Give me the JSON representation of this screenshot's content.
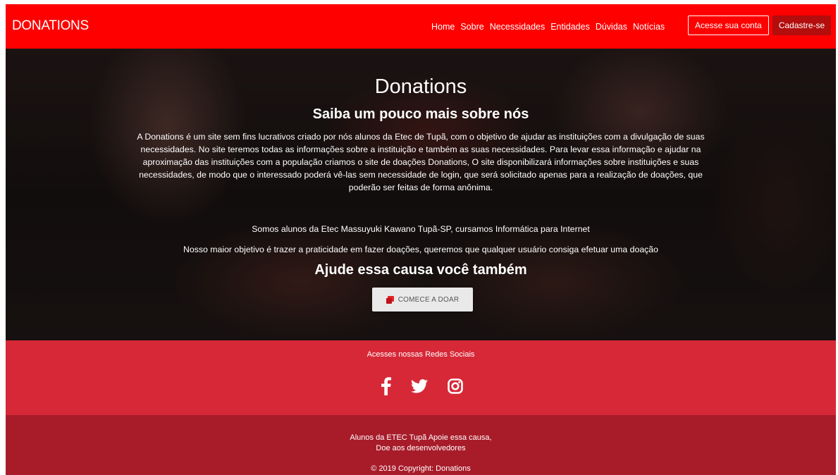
{
  "nav": {
    "brand": "DONATIONS",
    "links": [
      "Home",
      "Sobre",
      "Necessidades",
      "Entidades",
      "Dúvidas",
      "Notícias"
    ],
    "login_button": "Acesse sua conta",
    "signup_button": "Cadastre-se"
  },
  "hero": {
    "title": "Donations",
    "subtitle": "Saiba um pouco mais sobre nós",
    "paragraph": "A Donations é um site sem fins lucrativos criado por nós alunos da Etec de Tupã, com o objetivo de ajudar as instituições com a divulgação de suas necessidades. No site teremos todas as informações sobre a instituição e também as suas necessidades. Para levar essa informação e ajudar na aproximação das instituições com a população criamos o site de doações Donations, O site disponibilizará informações sobre instituições e suas necessidades, de modo que o interessado poderá vê-las sem necessidade de login, que será solicitado apenas para a realização de doações, que poderão ser feitas de forma anônima.",
    "line1": "Somos alunos da Etec Massuyuki Kawano Tupã-SP, cursamos Informática para Internet",
    "line2": "Nosso maior objetivo é trazer a praticidade em fazer doações, queremos que qualquer usuário consiga efetuar uma doação",
    "call_to_action": "Ajude essa causa você também",
    "donate_button": "COMECE A DOAR"
  },
  "social": {
    "title": "Acesses nossas Redes Sociais",
    "icons": [
      "facebook-icon",
      "twitter-icon",
      "instagram-icon"
    ]
  },
  "footer": {
    "line1": "Alunos da ETEC Tupã Apoie essa causa,",
    "line2": "Doe aos desenvolvedores",
    "copyright": "© 2019 Copyright: Donations"
  },
  "colors": {
    "navbar": "#fe0000",
    "signup": "#b30d0d",
    "social_band": "#d72837",
    "footer": "#a81c2a"
  }
}
